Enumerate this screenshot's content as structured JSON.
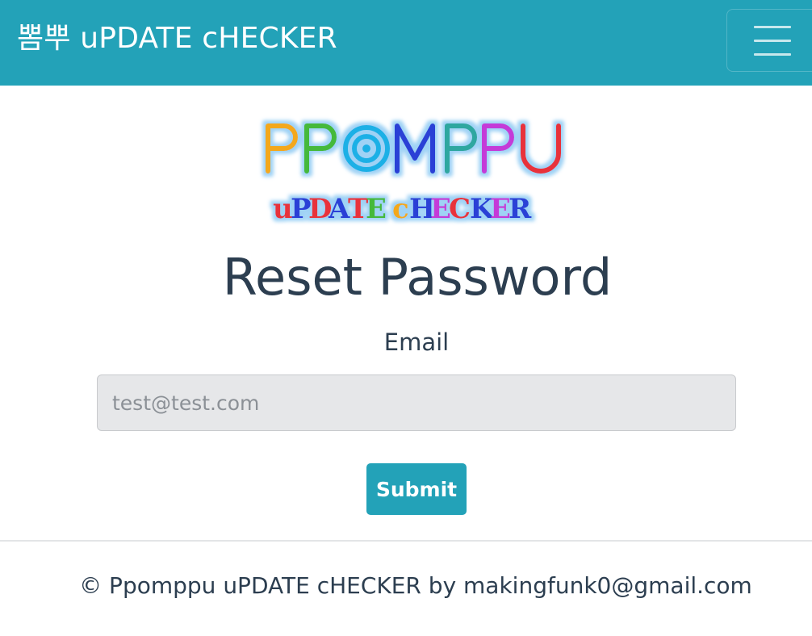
{
  "theme": {
    "brand_color": "#23a2b8",
    "text_color": "#2c3e50"
  },
  "navbar": {
    "brand": "뽐뿌 uPDATE cHECKER",
    "toggle_icon": "hamburger-menu-icon"
  },
  "logo": {
    "line1": "PPOMPPU",
    "line2": "uPDATE cHECKER"
  },
  "form": {
    "title": "Reset Password",
    "email_label": "Email",
    "email_placeholder": "test@test.com",
    "email_value": "",
    "submit_label": "Submit"
  },
  "footer": {
    "text": "© Ppomppu uPDATE cHECKER by makingfunk0@gmail.com"
  }
}
